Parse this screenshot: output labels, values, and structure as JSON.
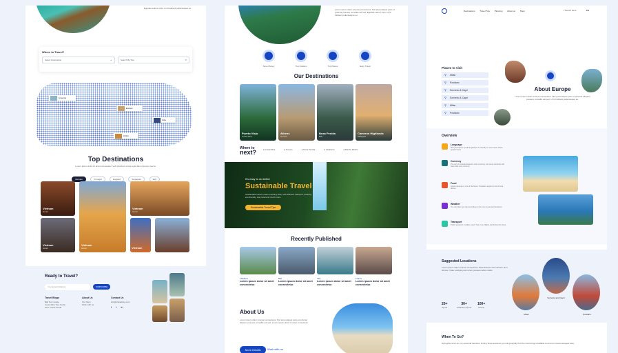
{
  "panel1": {
    "where_label": "Where to Travel?",
    "select_destination": "Select Destination",
    "search_placeholder": "Search By Site",
    "map_labels": [
      "America",
      "Europe",
      "Asia",
      "Africa"
    ],
    "top_title": "Top Destinations",
    "top_sub": "Lorem ipsum dolor sit amet consectetur. Velit tincidunt ornare eget diam a ipsum viverra.",
    "filters": [
      "Vietnam",
      "Portugal",
      "England",
      "Singapore",
      "Italy"
    ],
    "cards": [
      {
        "name": "Vietnam",
        "sub": "Hanoi"
      },
      {
        "name": "Vietnam",
        "sub": "Hanoi"
      },
      {
        "name": "Vietnam",
        "sub": "Hanoi"
      },
      {
        "name": "Vietnam",
        "sub": "Hanoi"
      },
      {
        "name": "Vietnam",
        "sub": "Hanoi"
      }
    ],
    "ready_title": "Ready to Travel?",
    "email_placeholder": "Your Email Address",
    "subscribe": "SUBSCRIBE",
    "footer_cols": [
      {
        "title": "Travel Blogs",
        "items": [
          "Bali Tour Guide",
          "Costa Rica Tour Guide",
          "Peru Travel Guide"
        ]
      },
      {
        "title": "About Us",
        "items": [
          "Our Story",
          "Work with us"
        ]
      },
      {
        "title": "Contact Us",
        "items": [
          "info@travelblog.com"
        ]
      }
    ],
    "social": [
      "f",
      "t",
      "in"
    ]
  },
  "panel2": {
    "icons": [
      "Save Money",
      "Tour Guides",
      "Top Places",
      "Easy Travel"
    ],
    "dest_title": "Our Destinations",
    "dest_cards": [
      {
        "name": "Puerto Viejo",
        "sub": "Costa Rica"
      },
      {
        "name": "Athens",
        "sub": "Greece"
      },
      {
        "name": "Nusa Penida",
        "sub": "Bali"
      },
      {
        "name": "Cameron Highlands",
        "sub": "Malaysia"
      }
    ],
    "where_to": "Where to",
    "next": "next?",
    "next_places": [
      "Costa Rica",
      "Greece",
      "Nusa Penida",
      "Catalonia",
      "Machu Picchu"
    ],
    "hero_small": "It's easy to do better",
    "hero_title": "Sustainable Travel",
    "hero_desc": "Sustainable travel means traveling slow, with different transport, packing eco-friendly, stay local and much more.",
    "hero_btn": "Sustainable Travel Tips",
    "recent_title": "Recently Published",
    "recent": [
      {
        "tag": "Thailand",
        "title": "Lorem ipsum dolor sit amet consectetur."
      },
      {
        "tag": "Bali",
        "title": "Lorem ipsum dolor sit amet consectetur."
      },
      {
        "tag": "Italy",
        "title": "Lorem ipsum dolor sit amet consectetur."
      },
      {
        "tag": "France",
        "title": "Lorem ipsum dolor sit amet consectetur."
      }
    ],
    "about_title": "About Us",
    "about_text": "Lorem ipsum dolor sit amet consectetur. Nisl amet aliquet justo et pulvinar aliquam posuere convallis est sed. Lorem ipsum dolor sit amet consectetur.",
    "more_btn": "More Details",
    "work_link": "Work with us"
  },
  "panel3": {
    "nav": [
      "Destinations",
      "Travel Tips",
      "Planning",
      "About us",
      "Shop"
    ],
    "search": "Search Here",
    "lang": "EN",
    "places_title": "Places to visit",
    "places": [
      "Milan",
      "Positano",
      "Sorrento & Capri",
      "Sorrento & Capri",
      "Milan",
      "Positano"
    ],
    "about_title": "About Europe",
    "about_text": "Lorem ipsum dolor sit amet consectetur. Nisl amet aliquet justo et pulvinar aliquam posuere convallis est sed. Ut id habitant pellentesque eu.",
    "overview_title": "Overview",
    "overview": [
      {
        "t": "Language",
        "d": "Many European speak English as it's friendly to most areas where people travel.",
        "c": "#f2a81d"
      },
      {
        "t": "Currency",
        "d": "The euro is most European's main currency, but some countries still have their own currency.",
        "c": "#17727a"
      },
      {
        "t": "Food",
        "d": "Food in Europe is one of the finest. Travellers explore a lot of local dishes.",
        "c": "#e8542c"
      },
      {
        "t": "Weather",
        "d": "You can plan your trip according to the time of year and locations.",
        "c": "#7b2fd1"
      },
      {
        "t": "Transport",
        "d": "Public transport is widely used. Train, bus, flights and ferries link cities.",
        "c": "#2ec4a6"
      }
    ],
    "suggested_title": "Suggested Locations",
    "suggested_text": "Lorem ipsum dolor sit amet consectetur. Pellentesque nisl nascetur arcu ultrices. Vitae volutpat proin lorem posuere tellus mattis.",
    "stats": [
      {
        "n": "20+",
        "l": "Spots"
      },
      {
        "n": "30+",
        "l": "Attraction Spots"
      },
      {
        "n": "100+",
        "l": "Hotels"
      }
    ],
    "locations": [
      "Milan",
      "Sorrento and Capri",
      "Positano"
    ],
    "when_title": "When To Go?",
    "when_text": "Spring/Summer are my personal favorites. During these seasons you will generally find the most things available to do and crowd-managed sites."
  }
}
